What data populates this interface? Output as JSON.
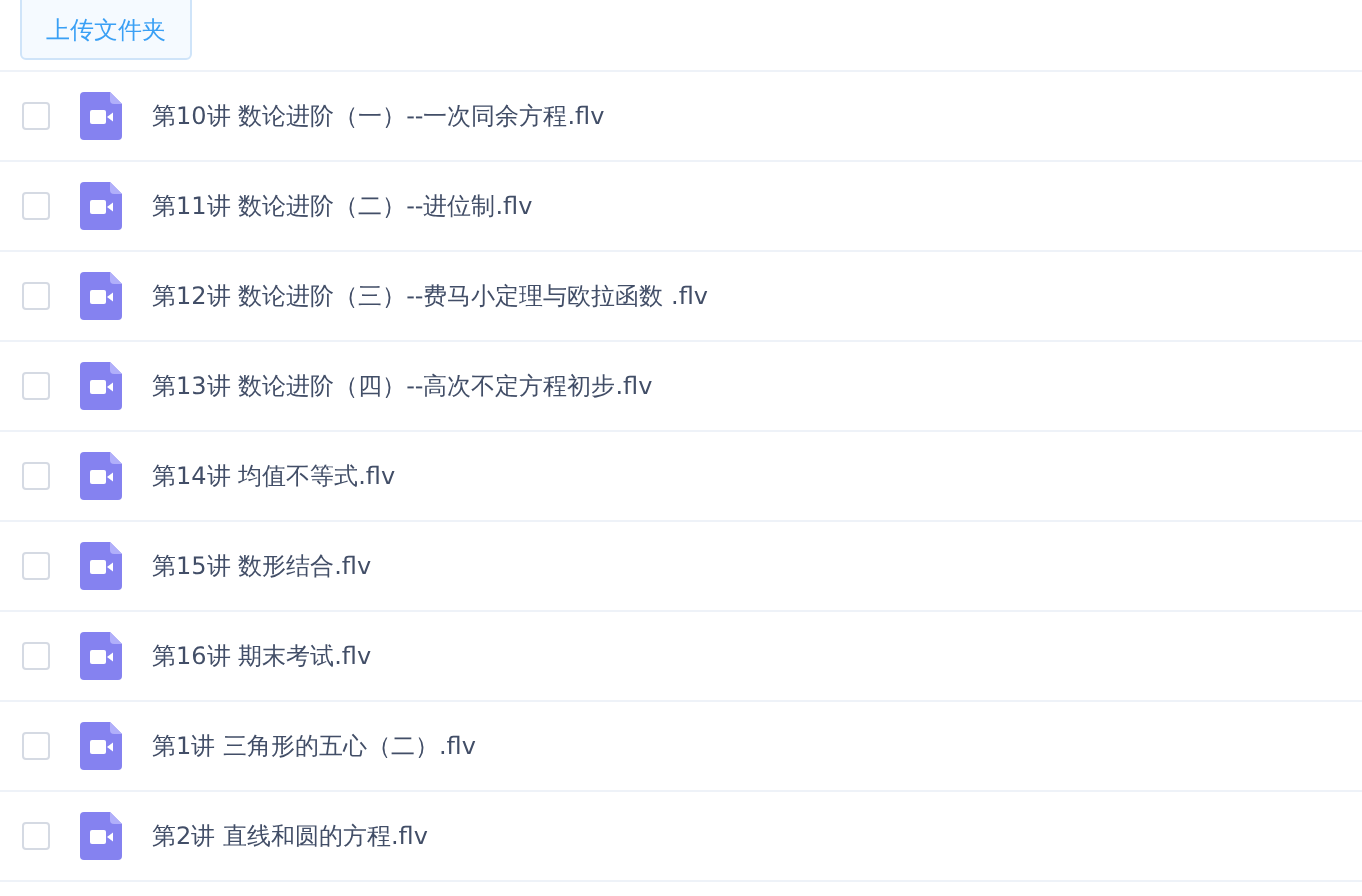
{
  "upload_button": "上传文件夹",
  "files": [
    {
      "name": "第10讲 数论进阶（一）--一次同余方程.flv",
      "checked": false
    },
    {
      "name": "第11讲 数论进阶（二）--进位制.flv",
      "checked": false
    },
    {
      "name": "第12讲 数论进阶（三）--费马小定理与欧拉函数 .flv",
      "checked": false
    },
    {
      "name": "第13讲 数论进阶（四）--高次不定方程初步.flv",
      "checked": false
    },
    {
      "name": "第14讲 均值不等式.flv",
      "checked": false
    },
    {
      "name": "第15讲 数形结合.flv",
      "checked": false
    },
    {
      "name": "第16讲 期末考试.flv",
      "checked": false
    },
    {
      "name": "第1讲 三角形的五心（二）.flv",
      "checked": false
    },
    {
      "name": "第2讲 直线和圆的方程.flv",
      "checked": false
    }
  ]
}
